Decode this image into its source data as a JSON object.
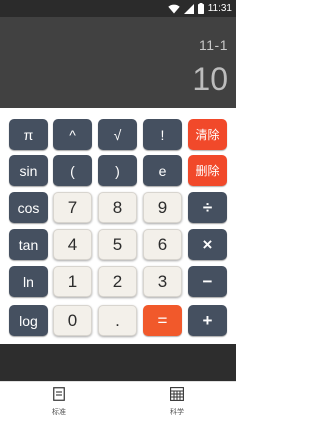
{
  "status_bar": {
    "time": "11:31",
    "icons": [
      "wifi-icon",
      "cell-signal-icon",
      "battery-icon"
    ]
  },
  "display": {
    "expression": "11-1",
    "result": "10"
  },
  "keypad": {
    "rows": [
      [
        {
          "label": "π",
          "style": "dark"
        },
        {
          "label": "^",
          "style": "dark"
        },
        {
          "label": "√",
          "style": "dark"
        },
        {
          "label": "!",
          "style": "dark"
        },
        {
          "label": "清除",
          "style": "red"
        }
      ],
      [
        {
          "label": "sin",
          "style": "dark"
        },
        {
          "label": "(",
          "style": "dark"
        },
        {
          "label": ")",
          "style": "dark"
        },
        {
          "label": "e",
          "style": "dark"
        },
        {
          "label": "删除",
          "style": "red"
        }
      ],
      [
        {
          "label": "cos",
          "style": "dark"
        },
        {
          "label": "7",
          "style": "light"
        },
        {
          "label": "8",
          "style": "light"
        },
        {
          "label": "9",
          "style": "light"
        },
        {
          "label": "÷",
          "style": "dark"
        }
      ],
      [
        {
          "label": "tan",
          "style": "dark"
        },
        {
          "label": "4",
          "style": "light"
        },
        {
          "label": "5",
          "style": "light"
        },
        {
          "label": "6",
          "style": "light"
        },
        {
          "label": "×",
          "style": "dark"
        }
      ],
      [
        {
          "label": "ln",
          "style": "dark"
        },
        {
          "label": "1",
          "style": "light"
        },
        {
          "label": "2",
          "style": "light"
        },
        {
          "label": "3",
          "style": "light"
        },
        {
          "label": "−",
          "style": "dark"
        }
      ],
      [
        {
          "label": "log",
          "style": "dark"
        },
        {
          "label": "0",
          "style": "light"
        },
        {
          "label": ".",
          "style": "light"
        },
        {
          "label": "=",
          "style": "orange"
        },
        {
          "label": "+",
          "style": "dark"
        }
      ]
    ]
  },
  "bottom_nav": {
    "items": [
      {
        "label": "标准",
        "icon": "standard-calculator-icon"
      },
      {
        "label": "科学",
        "icon": "scientific-calculator-icon"
      }
    ]
  },
  "colors": {
    "display_bg": "#414141",
    "dark_key": "#455060",
    "light_key": "#f3f0ea",
    "red_key": "#f1492a",
    "orange_key": "#f1592b",
    "bottom_band": "#2d2d2d"
  }
}
